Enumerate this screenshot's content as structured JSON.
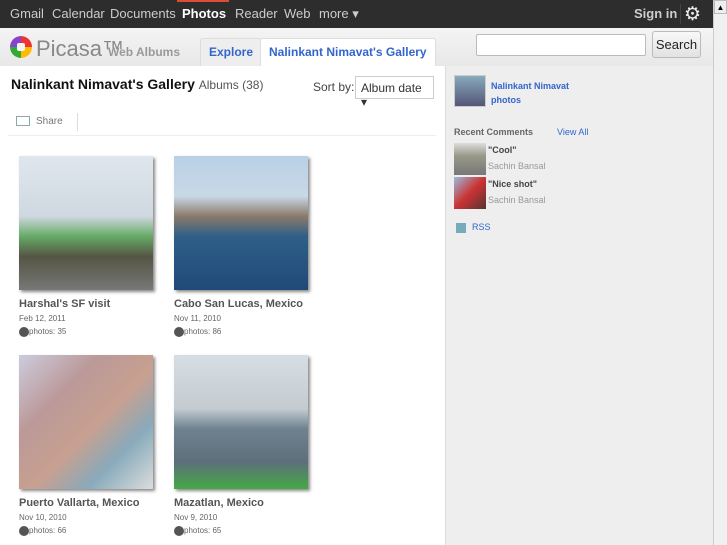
{
  "topnav": {
    "items": [
      "Gmail",
      "Calendar",
      "Documents",
      "Photos",
      "Reader",
      "Web",
      "more ▾"
    ],
    "active": "Photos",
    "sign_in": "Sign in"
  },
  "header": {
    "logo": "Picasa™",
    "subtitle": "Web Albums",
    "tabs": [
      "Explore",
      "Nalinkant Nimavat's Gallery"
    ],
    "search_value": "",
    "search_button": "Search"
  },
  "gallery": {
    "title": "Nalinkant Nimavat's Gallery",
    "albums_count": "Albums (38)",
    "sort_label": "Sort by:",
    "sort_value": "Album date ▾",
    "share": "Share",
    "albums": [
      {
        "name": "Harshal's SF visit",
        "date": "Feb 12, 2011",
        "photos": "photos: 35"
      },
      {
        "name": "Cabo San Lucas, Mexico",
        "date": "Nov 11, 2010",
        "photos": "photos: 86"
      },
      {
        "name": "Puerto Vallarta, Mexico",
        "date": "Nov 10, 2010",
        "photos": "photos: 66"
      },
      {
        "name": "Mazatlan, Mexico",
        "date": "Nov 9, 2010",
        "photos": "photos: 65"
      }
    ]
  },
  "sidebar": {
    "user_name": "Nalinkant Nimavat",
    "user_photos": "photos",
    "recent_comments": "Recent Comments",
    "view_all": "View All",
    "comments": [
      {
        "text": "\"Cool\"",
        "author": "Sachin Bansal"
      },
      {
        "text": "\"Nice shot\"",
        "author": "Sachin Bansal"
      }
    ],
    "rss": "RSS"
  }
}
